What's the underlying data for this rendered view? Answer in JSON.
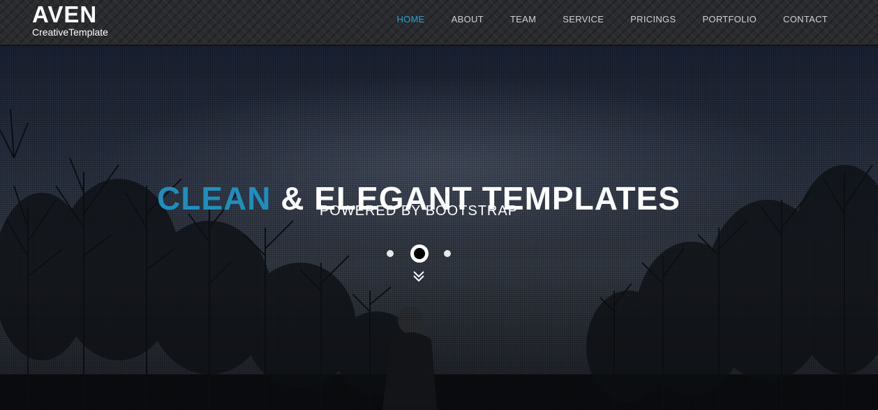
{
  "brand": {
    "title": "AVEN",
    "subtitle": "CreativeTemplate"
  },
  "nav": {
    "items": [
      "HOME",
      "ABOUT",
      "TEAM",
      "SERVICE",
      "PRICINGS",
      "PORTFOLIO",
      "CONTACT"
    ],
    "active": "HOME"
  },
  "hero": {
    "headline_accent": "CLEAN",
    "headline_rest": " & ELEGANT TEMPLATES",
    "subheadline": "POWERED BY BOOTSTRAP",
    "slide_count": 3,
    "active_slide": 2
  },
  "colors": {
    "accent": "#1d8fbf",
    "nav_active": "#2a9fd6",
    "nav_text": "#cfd2d6"
  },
  "icons": {
    "scroll_down": "double-chevron-down-icon"
  }
}
